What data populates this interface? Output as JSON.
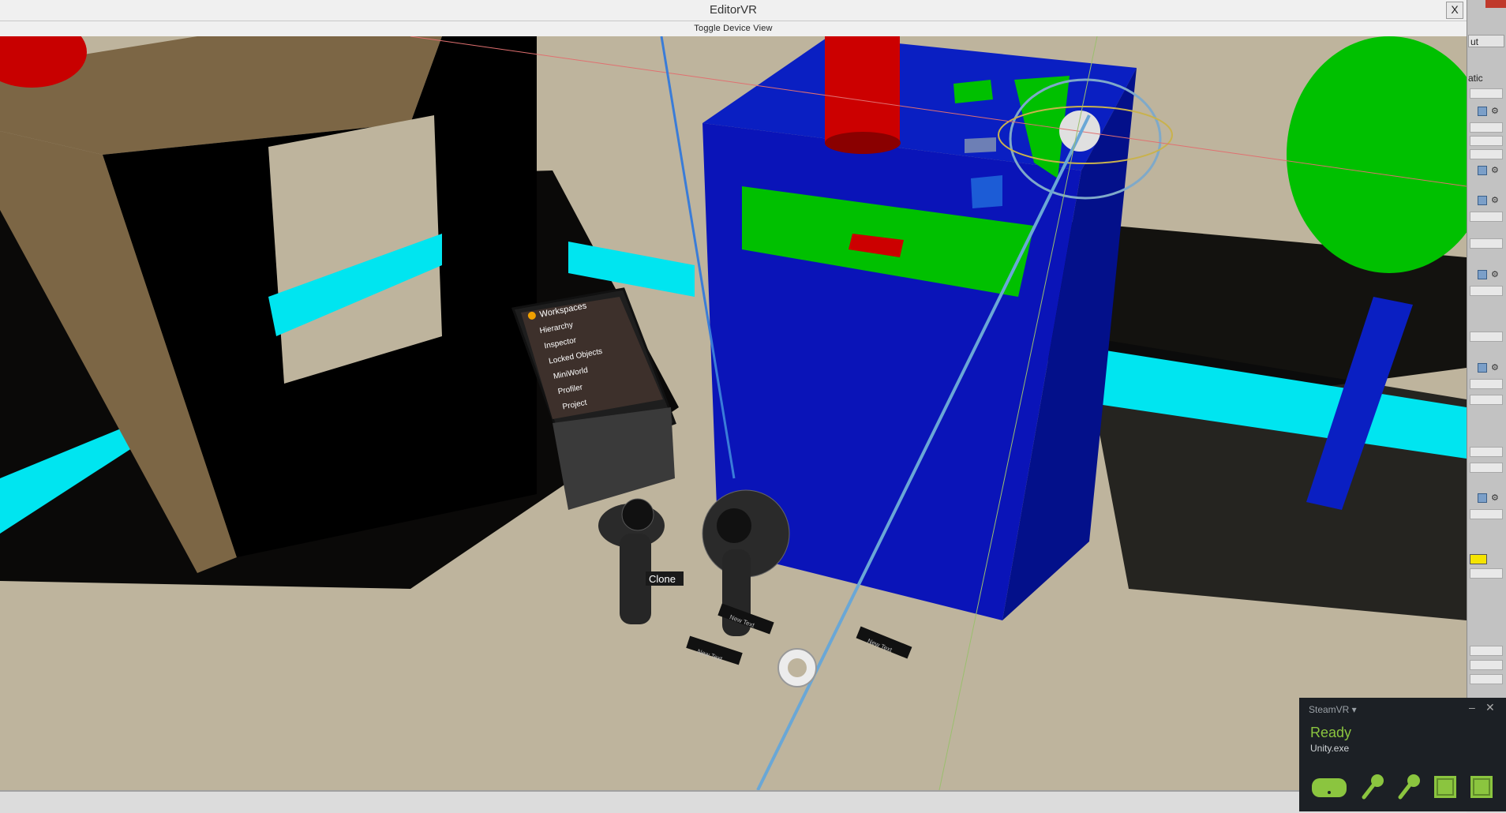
{
  "window": {
    "title": "EditorVR",
    "close_label": "X"
  },
  "toolbar": {
    "toggle_device_view": "Toggle Device View"
  },
  "scene": {
    "workspaces_menu": {
      "title": "Workspaces",
      "items": [
        "Hierarchy",
        "Inspector",
        "Locked Objects",
        "MiniWorld",
        "Profiler",
        "Project"
      ]
    },
    "tooltip": "Clone",
    "floor_labels": [
      "New Text",
      "New Text",
      "New Text"
    ]
  },
  "right_panel": {
    "dropdown_value": "ut",
    "static_label": "atic"
  },
  "steamvr": {
    "title": "SteamVR ▾",
    "minimize": "–",
    "close": "✕",
    "status": "Ready",
    "app": "Unity.exe"
  },
  "colors": {
    "sky": "#beb49d",
    "blue_box": "#0a1fc2",
    "green": "#00c000",
    "red": "#cc0000",
    "cyan": "#00e5f0",
    "brown": "#7c6645",
    "steam_green": "#8bc53f"
  }
}
